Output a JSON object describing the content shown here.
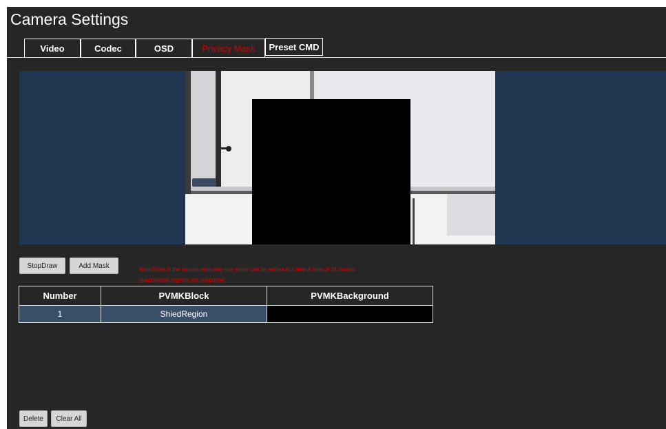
{
  "window": {
    "title": "Camera Settings"
  },
  "tabs": [
    {
      "label": "Video"
    },
    {
      "label": "Codec"
    },
    {
      "label": "OSD"
    },
    {
      "label": "Privacy Mask",
      "active": true
    },
    {
      "label": "Preset CMD"
    }
  ],
  "toolbar": {
    "stop_draw_label": "StopDraw",
    "add_mask_label": "Add Mask"
  },
  "note": "Note:Draw in the special area,only one mask can be added at a time,A total of 24 convex quadrilateral regions are supported",
  "table": {
    "headers": [
      "Number",
      "PVMKBlock",
      "PVMKBackground"
    ],
    "rows": [
      {
        "number": "1",
        "block": "ShiedRegion",
        "background": ""
      }
    ]
  },
  "footer": {
    "delete_label": "Delete",
    "clear_all_label": "Clear All"
  },
  "colors": {
    "panel_bg": "#262626",
    "active_tab": "#d40000",
    "video_bg": "#213650",
    "mask": "#000000",
    "selected_row": "#3a4e68"
  }
}
